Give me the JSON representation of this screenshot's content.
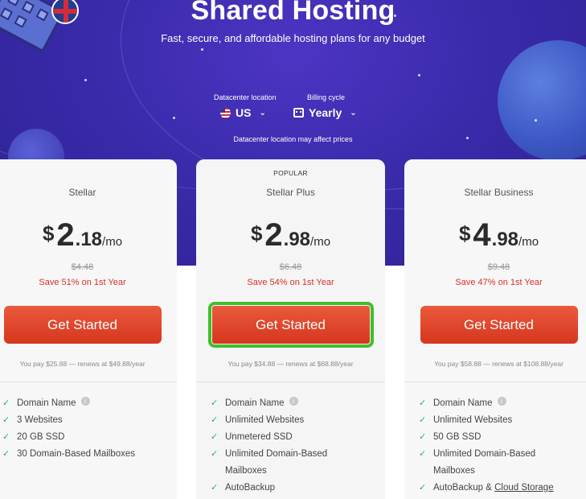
{
  "header": {
    "title": "Shared Hosting",
    "subtitle": "Fast, secure, and affordable hosting plans for any budget"
  },
  "selectors": {
    "location": {
      "caption": "Datacenter location",
      "value": "US",
      "flag": "us-flag-icon"
    },
    "billing": {
      "caption": "Billing cycle",
      "value": "Yearly",
      "icon": "calendar-icon"
    },
    "note": "Datacenter location may affect prices"
  },
  "plans": [
    {
      "name": "Stellar",
      "popular_label": "",
      "currency": "$",
      "price_int": "2",
      "price_dec": ".18",
      "per": "/mo",
      "old_price": "$4.48",
      "save": "Save 51% on 1st Year",
      "button": "Get Started",
      "pay_note": "You pay $25.88 — renews at $49.88/year",
      "features": [
        "Domain Name",
        "3 Websites",
        "20 GB SSD",
        "30 Domain-Based Mailboxes"
      ]
    },
    {
      "name": "Stellar Plus",
      "popular_label": "POPULAR",
      "currency": "$",
      "price_int": "2",
      "price_dec": ".98",
      "per": "/mo",
      "old_price": "$6.48",
      "save": "Save 54% on 1st Year",
      "button": "Get Started",
      "pay_note": "You pay $34.88 — renews at $68.88/year",
      "features": [
        "Domain Name",
        "Unlimited Websites",
        "Unmetered SSD",
        "Unlimited Domain-Based",
        "Mailboxes",
        "AutoBackup"
      ]
    },
    {
      "name": "Stellar Business",
      "popular_label": "",
      "currency": "$",
      "price_int": "4",
      "price_dec": ".98",
      "per": "/mo",
      "old_price": "$9.48",
      "save": "Save 47% on 1st Year",
      "button": "Get Started",
      "pay_note": "You pay $58.88 — renews at $108.88/year",
      "features": [
        "Domain Name",
        "Unlimited Websites",
        "50 GB SSD",
        "Unlimited Domain-Based",
        "Mailboxes",
        "AutoBackup & ",
        "Cloud Storage"
      ]
    }
  ],
  "colors": {
    "hero_bg": "#3a2bab",
    "button": "#e04a2c",
    "save_text": "#d9302a",
    "check": "#32a38f",
    "highlight": "#3fbf2a"
  }
}
